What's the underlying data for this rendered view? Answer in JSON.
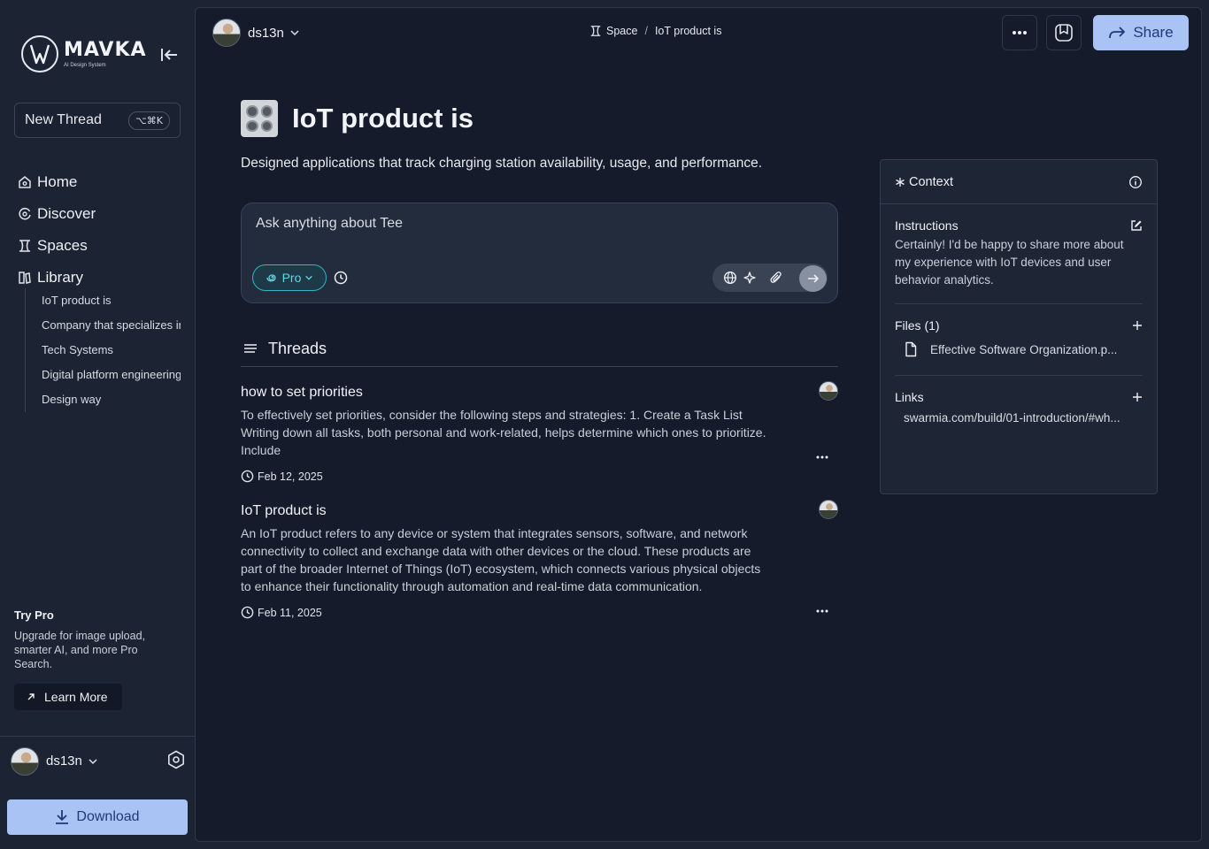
{
  "brand": {
    "name": "MAVKA",
    "tagline": "AI Design System"
  },
  "sidebar": {
    "new_thread_label": "New Thread",
    "new_thread_shortcut": "⌥⌘K",
    "nav": [
      {
        "label": "Home",
        "icon": "home-icon"
      },
      {
        "label": "Discover",
        "icon": "discover-icon"
      },
      {
        "label": "Spaces",
        "icon": "spaces-icon"
      },
      {
        "label": "Library",
        "icon": "library-icon"
      }
    ],
    "library_items": [
      "IoT product is",
      "Company that specializes in",
      "Tech Systems",
      "Digital platform engineering",
      "Design way"
    ],
    "try_pro": {
      "title": "Try Pro",
      "text": "Upgrade for image upload, smarter AI, and more Pro Search.",
      "button": "Learn More"
    },
    "user_name": "ds13n",
    "download_label": "Download"
  },
  "topbar": {
    "user_name": "ds13n",
    "breadcrumb": {
      "space": "Space",
      "sep": "/",
      "current": "IoT product is"
    },
    "share_label": "Share"
  },
  "space": {
    "title": "IoT product is",
    "description": "Designed applications that track charging station availability, usage, and performance."
  },
  "ask": {
    "placeholder": "Ask anything about Tee",
    "mode_label": "Pro"
  },
  "threads": {
    "title": "Threads",
    "items": [
      {
        "title": "how to set priorities",
        "body": "To effectively set priorities, consider the following steps and strategies: 1. Create a Task List Writing down all tasks, both personal and work-related, helps determine which ones to prioritize. Include",
        "date": "Feb 12, 2025"
      },
      {
        "title": "IoT product is",
        "body": "An IoT product refers to any device or system that integrates sensors, software, and network connectivity to collect and exchange data with other devices or the cloud. These products are part of the broader Internet of Things (IoT) ecosystem, which connects various physical objects to enhance their functionality through automation and real-time data communication.",
        "date": "Feb 11, 2025"
      }
    ]
  },
  "context": {
    "title": "Context",
    "instructions_title": "Instructions",
    "instructions_text": "Certainly! I'd be happy to share more about my experience with IoT devices and user behavior analytics.",
    "files_title": "Files (1)",
    "file_name": "Effective Software Organization.p...",
    "links_title": "Links",
    "link": "swarmia.com/build/01-introduction/#wh..."
  },
  "colors": {
    "accent": "#a9c3f5",
    "accent_text": "#1e3a78",
    "pro": "#2fb5c4",
    "background": "#151b2a"
  }
}
